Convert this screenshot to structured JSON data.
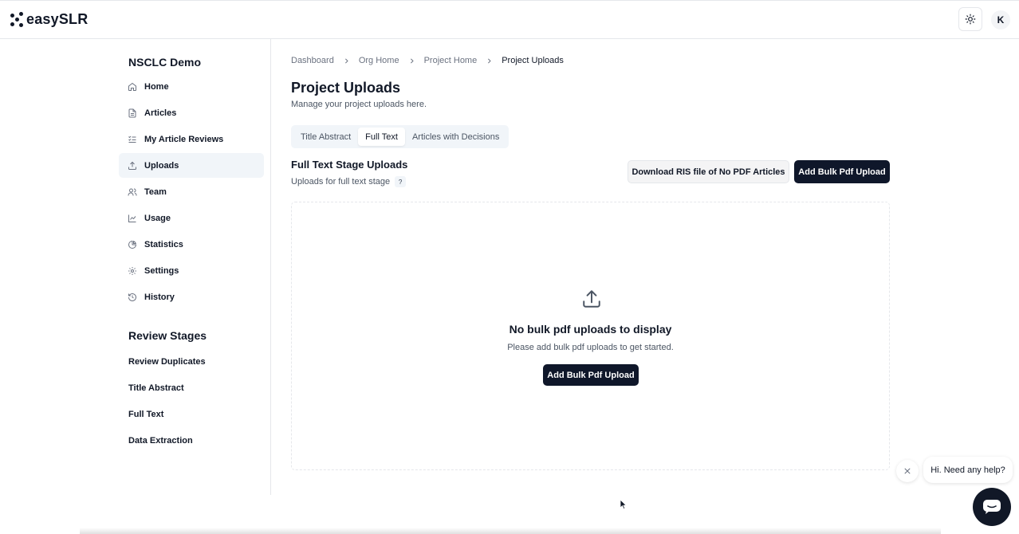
{
  "app": {
    "logo_text": "easySLR",
    "avatar_initial": "K"
  },
  "sidebar": {
    "project_name": "NSCLC Demo",
    "items": [
      {
        "label": "Home",
        "icon": "home-icon"
      },
      {
        "label": "Articles",
        "icon": "document-icon"
      },
      {
        "label": "My Article Reviews",
        "icon": "list-check-icon"
      },
      {
        "label": "Uploads",
        "icon": "upload-icon",
        "active": true
      },
      {
        "label": "Team",
        "icon": "users-icon"
      },
      {
        "label": "Usage",
        "icon": "line-chart-icon"
      },
      {
        "label": "Statistics",
        "icon": "pie-chart-icon"
      },
      {
        "label": "Settings",
        "icon": "gear-icon"
      },
      {
        "label": "History",
        "icon": "history-icon"
      }
    ],
    "review_stages_title": "Review Stages",
    "stages": [
      "Review Duplicates",
      "Title Abstract",
      "Full Text",
      "Data Extraction"
    ]
  },
  "breadcrumb": [
    "Dashboard",
    "Org Home",
    "Project Home",
    "Project Uploads"
  ],
  "page": {
    "title": "Project Uploads",
    "subtitle": "Manage your project uploads here."
  },
  "tabs": [
    {
      "label": "Title Abstract",
      "active": false
    },
    {
      "label": "Full Text",
      "active": true
    },
    {
      "label": "Articles with Decisions",
      "active": false
    }
  ],
  "section": {
    "title": "Full Text Stage Uploads",
    "subtitle": "Uploads for full text stage",
    "help": "?",
    "download_label": "Download RIS file of No PDF Articles",
    "add_label": "Add Bulk Pdf Upload"
  },
  "empty_state": {
    "title": "No bulk pdf uploads to display",
    "subtitle": "Please add bulk pdf uploads to get started.",
    "button_label": "Add Bulk Pdf Upload"
  },
  "chat": {
    "bubble_text": "Hi. Need any help?"
  }
}
